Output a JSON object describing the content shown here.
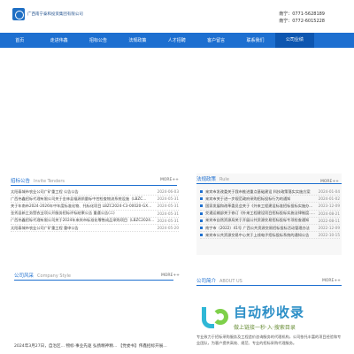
{
  "header": {
    "company_name": "广西南宁泰和投资集团有限公司",
    "phone1": "南宁：0771-5628189",
    "phone2": "南宁：0772-6015228"
  },
  "nav": {
    "items": [
      {
        "label": "首页"
      },
      {
        "label": "走进伟鑫"
      },
      {
        "label": "招标公告"
      },
      {
        "label": "法规政策"
      },
      {
        "label": "人才招聘"
      },
      {
        "label": "客户留言"
      },
      {
        "label": "联系我们"
      },
      {
        "label": "公司业绩"
      }
    ]
  },
  "tenders": {
    "title": "招标公告",
    "title_en": "Invite Tenders",
    "more": "MORE++",
    "items": [
      {
        "text": "太阳泰城市农业公司广矿重工程 公告公告",
        "date": "2024-06-03"
      },
      {
        "text": "广西伟鑫招标代理有限公司关于金林县福源质量标中控检查物流系统设施（LBZC...",
        "date": "2024-05-31"
      },
      {
        "text": "关于年南市2024-2026年中年度标准化物、托标化项目 LBZC2024-C3-00020-GXWP...",
        "date": "2024-05-31"
      },
      {
        "text": "金秀县新工务暨农业项公开服务招标评标结果公告 重遇公告(二)",
        "date": "2024-05-31"
      },
      {
        "text": "广西伟鑫招标代理有限公司关于2024年来宾市标准化零售成品采购项目（LBZC2024-C3...",
        "date": "2024-05-31"
      },
      {
        "text": "太阳泰城市农业公司广矿重工程 重申公告",
        "date": "2024-05-20"
      }
    ]
  },
  "regulations": {
    "title": "法规政策",
    "title_en": "Rule",
    "more": "MORE++",
    "items": [
      {
        "text": "来宾市发改委关于我市推进重点基础建设 科技政策落实实施方案",
        "date": "2024-01-04"
      },
      {
        "text": "来宾市关于进一步规范政府采购招标投标行为的通知",
        "date": "2024-01-02"
      },
      {
        "text": "国家发展和改革委员会关于《外来工程建设标准招标投标实施办法》",
        "date": "2023-12-09"
      },
      {
        "text": "交通运输部关于修订《外来工程建设项目招标投标实施法律制度...》",
        "date": "2024-08-21"
      },
      {
        "text": "来宾市自然资源局关于开展公共资源交易招标投标专项检查通知",
        "date": "2022-08-11"
      },
      {
        "text": "南宁市（2022）41号 广西公共资源交易招标投标活动管理办法",
        "date": "2022-12-09"
      },
      {
        "text": "来宾市公共资源交易中心关于上线电子招标投标系统的通知公告",
        "date": "2022-10-15"
      }
    ]
  },
  "company_style": {
    "title": "公司风采",
    "title_en": "Company Style",
    "more": "MORE++",
    "snippet": "2024年3月27日，自治区...  物标·事业先驱 弘扬精神精... 【党委书】伟鑫招标开展..."
  },
  "about": {
    "title": "公司简介",
    "title_en": "ABOUT US",
    "more": "MORE++",
    "text": "专业致力于招标采购服务及工程造价咨询服务的代理机构，公司依托丰富的项目经验和专业团队，为客户提供高效、规范、专业的招标采购代理服务。"
  },
  "watermark": {
    "title": "自动秒收录",
    "subtitle": "做上链接一秒·入·搜索目录"
  },
  "colors": {
    "nav_bg": "#1d6fd0",
    "accent": "#1d6fd0"
  }
}
